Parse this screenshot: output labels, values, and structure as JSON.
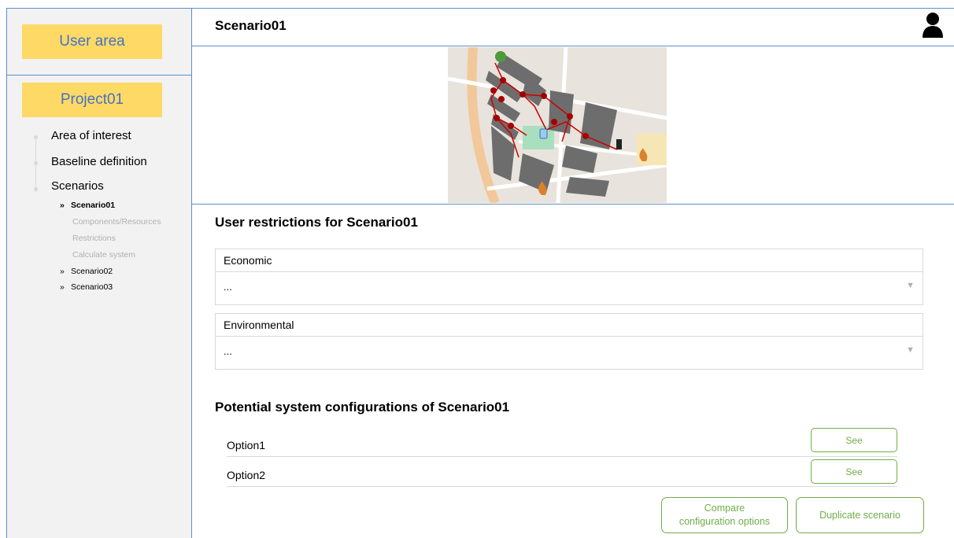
{
  "sidebar": {
    "user_area_label": "User area",
    "project_label": "Project01",
    "nav": [
      {
        "label": "Area of interest"
      },
      {
        "label": "Baseline definition"
      },
      {
        "label": "Scenarios"
      }
    ],
    "scenarios": [
      {
        "marker": "»",
        "label": "Scenario01",
        "active": true
      },
      {
        "marker": "»",
        "label": "Scenario02"
      },
      {
        "marker": "»",
        "label": "Scenario03"
      }
    ],
    "scenario01_steps": [
      "Components/Resources",
      "Restrictions",
      "Calculate system"
    ]
  },
  "header": {
    "title": "Scenario01",
    "user_icon": "user-icon"
  },
  "map": {
    "icons": [
      "tree-icon",
      "flame-icon",
      "tank-icon",
      "chimney-icon"
    ],
    "colors": {
      "network": "#cc0000",
      "building": "#6d6d6d",
      "road": "#f2c89a",
      "park": "#a9dfbf"
    }
  },
  "restrictions": {
    "title": "User restrictions for Scenario01",
    "groups": [
      {
        "label": "Economic",
        "value": "...",
        "arrow": "▼"
      },
      {
        "label": "Environmental",
        "value": "...",
        "arrow": "▼"
      }
    ]
  },
  "configurations": {
    "title": "Potential system configurations of Scenario01",
    "options": [
      {
        "label": "Option1",
        "button": "See"
      },
      {
        "label": "Option2",
        "button": "See"
      }
    ],
    "compare_line1": "Compare",
    "compare_line2": "configuration options",
    "duplicate_label": "Duplicate scenario"
  },
  "colors": {
    "accent_yellow": "#ffd966",
    "link_blue": "#4472c4",
    "button_green": "#70ad47",
    "border_blue": "#5b8fc7"
  }
}
